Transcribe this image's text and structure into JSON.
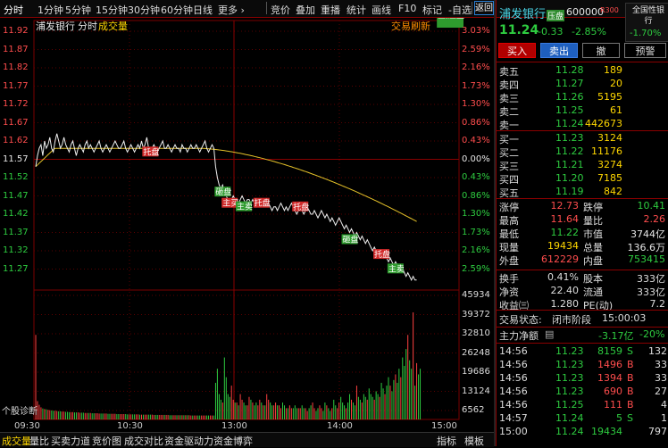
{
  "topbar": {
    "tabs": [
      "分时",
      "1分钟",
      "5分钟",
      "15分钟",
      "30分钟",
      "60分钟",
      "日线",
      "更多 ›"
    ],
    "tools": [
      "竞价",
      "叠加",
      "重播",
      "统计",
      "画线",
      "F10",
      "标记",
      "-自选"
    ],
    "back": "返回"
  },
  "chart": {
    "title_name": "浦发银行",
    "title_mode": "分时",
    "title_ind": "成交量",
    "refresh": "交易刷新",
    "prev_close": 11.57,
    "price_labels": [
      "11.92",
      "11.87",
      "11.82",
      "11.77",
      "11.72",
      "11.67",
      "11.62",
      "11.57",
      "11.52",
      "11.47",
      "11.42",
      "11.37",
      "11.32",
      "11.27"
    ],
    "pct_labels": [
      "3.03%",
      "2.59%",
      "2.16%",
      "1.73%",
      "1.30%",
      "0.86%",
      "0.43%",
      "0.00%",
      "0.43%",
      "0.86%",
      "1.30%",
      "1.73%",
      "2.16%",
      "2.59%"
    ],
    "vol_labels": [
      "45934",
      "39372",
      "32810",
      "26248",
      "19686",
      "13124",
      "6562"
    ],
    "time_labels": [
      "09:30",
      "10:30",
      "13:00",
      "14:00",
      "15:00"
    ],
    "diagnose": "个股诊断",
    "markers": [
      {
        "t": 65,
        "label": "托盘",
        "type": "buy"
      },
      {
        "t": 106,
        "label": "砸盘",
        "type": "sell"
      },
      {
        "t": 110,
        "label": "主买",
        "type": "buy"
      },
      {
        "t": 118,
        "label": "主卖",
        "type": "sell"
      },
      {
        "t": 128,
        "label": "托盘",
        "type": "buy"
      },
      {
        "t": 150,
        "label": "托盘",
        "type": "buy"
      },
      {
        "t": 178,
        "label": "砸盘",
        "type": "sell"
      },
      {
        "t": 196,
        "label": "托盘",
        "type": "buy"
      },
      {
        "t": 204,
        "label": "主卖",
        "type": "sell"
      },
      {
        "t": 232,
        "label": "主卖",
        "type": "sell"
      },
      {
        "t": 238,
        "label": "压盘",
        "type": "sell"
      }
    ],
    "price_series": [
      11.55,
      11.58,
      11.6,
      11.61,
      11.58,
      11.62,
      11.6,
      11.61,
      11.63,
      11.6,
      11.59,
      11.62,
      11.64,
      11.62,
      11.6,
      11.61,
      11.63,
      11.61,
      11.6,
      11.59,
      11.61,
      11.62,
      11.6,
      11.58,
      11.6,
      11.61,
      11.6,
      11.59,
      11.61,
      11.62,
      11.6,
      11.61,
      11.6,
      11.59,
      11.6,
      11.61,
      11.62,
      11.6,
      11.59,
      11.6,
      11.61,
      11.6,
      11.59,
      11.6,
      11.61,
      11.62,
      11.61,
      11.6,
      11.6,
      11.61,
      11.62,
      11.6,
      11.59,
      11.6,
      11.61,
      11.6,
      11.59,
      11.6,
      11.61,
      11.6,
      11.62,
      11.6,
      11.61,
      11.63,
      11.6,
      11.59,
      11.6,
      11.61,
      11.6,
      11.59,
      11.6,
      11.61,
      11.62,
      11.6,
      11.6,
      11.61,
      11.6,
      11.59,
      11.6,
      11.61,
      11.6,
      11.6,
      11.59,
      11.61,
      11.6,
      11.6,
      11.59,
      11.6,
      11.61,
      11.6,
      11.6,
      11.61,
      11.6,
      11.59,
      11.6,
      11.61,
      11.62,
      11.6,
      11.59,
      11.6,
      11.61,
      11.6,
      11.55,
      11.52,
      11.5,
      11.49,
      11.5,
      11.48,
      11.47,
      11.46,
      11.45,
      11.46,
      11.47,
      11.46,
      11.46,
      11.45,
      11.46,
      11.47,
      11.46,
      11.45,
      11.46,
      11.46,
      11.45,
      11.46,
      11.45,
      11.44,
      11.45,
      11.46,
      11.45,
      11.45,
      11.44,
      11.44,
      11.45,
      11.44,
      11.43,
      11.44,
      11.44,
      11.43,
      11.44,
      11.45,
      11.44,
      11.43,
      11.44,
      11.43,
      11.44,
      11.45,
      11.44,
      11.43,
      11.42,
      11.43,
      11.44,
      11.43,
      11.42,
      11.43,
      11.44,
      11.43,
      11.42,
      11.42,
      11.43,
      11.42,
      11.41,
      11.42,
      11.43,
      11.42,
      11.41,
      11.42,
      11.41,
      11.4,
      11.41,
      11.4,
      11.39,
      11.4,
      11.41,
      11.4,
      11.39,
      11.38,
      11.39,
      11.38,
      11.37,
      11.38,
      11.37,
      11.36,
      11.37,
      11.36,
      11.35,
      11.36,
      11.35,
      11.34,
      11.35,
      11.34,
      11.33,
      11.32,
      11.33,
      11.32,
      11.31,
      11.32,
      11.31,
      11.3,
      11.31,
      11.3,
      11.29,
      11.3,
      11.29,
      11.28,
      11.29,
      11.28,
      11.27,
      11.28,
      11.27,
      11.26,
      11.25,
      11.26,
      11.25,
      11.24,
      11.25,
      11.24,
      11.24
    ],
    "avg_series_start": 11.55,
    "avg_series_end": 11.4,
    "volumes": [
      30000,
      6500,
      5200,
      4300,
      3900,
      3700,
      3600,
      3400,
      3300,
      3200,
      3100,
      3100,
      3000,
      2900,
      2900,
      2800,
      2800,
      2700,
      2700,
      2600,
      2600,
      2600,
      2500,
      2500,
      2500,
      2400,
      2400,
      2400,
      2300,
      2300,
      2300,
      2300,
      2200,
      2200,
      2200,
      2200,
      2100,
      2100,
      2100,
      2100,
      2100,
      2000,
      2000,
      2000,
      2000,
      2000,
      1900,
      1900,
      1900,
      1900,
      1900,
      1900,
      1800,
      1800,
      1800,
      1800,
      1800,
      1800,
      1800,
      1700,
      1700,
      1700,
      1700,
      1700,
      1700,
      1700,
      1700,
      1600,
      1600,
      1600,
      1600,
      1600,
      1600,
      1600,
      1600,
      1600,
      1500,
      1500,
      1500,
      1500,
      1500,
      1500,
      1500,
      1500,
      1500,
      1500,
      1500,
      1500,
      1400,
      1400,
      1400,
      1400,
      1400,
      1400,
      1400,
      1400,
      1400,
      1400,
      1400,
      1400,
      1400,
      1400,
      13000,
      18000,
      9000,
      7000,
      6000,
      22000,
      15000,
      9000,
      8000,
      12000,
      7000,
      6000,
      6000,
      5000,
      9000,
      7000,
      6000,
      5000,
      5000,
      8000,
      7000,
      6000,
      5000,
      6000,
      5000,
      7000,
      6000,
      5000,
      5000,
      9000,
      7000,
      6000,
      5000,
      5000,
      6000,
      5000,
      5000,
      4000,
      6000,
      5000,
      4000,
      4000,
      5000,
      4000,
      4000,
      5000,
      4000,
      4000,
      4000,
      5000,
      4000,
      4000,
      3000,
      4000,
      5000,
      6000,
      4000,
      3000,
      4000,
      5000,
      4000,
      3000,
      6000,
      5000,
      4000,
      3000,
      4000,
      7000,
      5000,
      4000,
      6000,
      8000,
      6000,
      5000,
      4000,
      6000,
      9000,
      7000,
      6000,
      5000,
      12000,
      8000,
      7000,
      6000,
      9000,
      8000,
      7000,
      11000,
      9000,
      8000,
      7000,
      10000,
      9000,
      8000,
      13000,
      11000,
      9000,
      12000,
      15000,
      12000,
      10000,
      14000,
      16000,
      13000,
      18000,
      15000,
      22000,
      19000,
      25000,
      30000,
      21000,
      18000,
      38000,
      12000,
      20000,
      16000,
      18000
    ]
  },
  "panel": {
    "name": "浦发银行",
    "tag": "压盘",
    "code": "600000",
    "r_badge": "R300",
    "nat_label": "全国性银行",
    "nat_value": "-1.70%",
    "price": "11.24",
    "change": "-0.33",
    "change_pct": "-2.85%",
    "buy_btn": "买入",
    "sell_btn": "卖出",
    "cancel_btn": "撤",
    "warn_btn": "预警",
    "asks": [
      {
        "label": "卖五",
        "price": "11.28",
        "vol": "189"
      },
      {
        "label": "卖四",
        "price": "11.27",
        "vol": "20"
      },
      {
        "label": "卖三",
        "price": "11.26",
        "vol": "5195"
      },
      {
        "label": "卖二",
        "price": "11.25",
        "vol": "61"
      },
      {
        "label": "卖一",
        "price": "11.24",
        "vol": "442673"
      }
    ],
    "bids": [
      {
        "label": "买一",
        "price": "11.23",
        "vol": "3124"
      },
      {
        "label": "买二",
        "price": "11.22",
        "vol": "11176"
      },
      {
        "label": "买三",
        "price": "11.21",
        "vol": "3274"
      },
      {
        "label": "买四",
        "price": "11.20",
        "vol": "7185"
      },
      {
        "label": "买五",
        "price": "11.19",
        "vol": "842"
      }
    ],
    "stats": [
      {
        "l1": "涨停",
        "v1": "12.73",
        "c1": "red",
        "l2": "跌停",
        "v2": "10.41",
        "c2": "green"
      },
      {
        "l1": "最高",
        "v1": "11.64",
        "c1": "red",
        "l2": "量比",
        "v2": "2.26",
        "c2": "red"
      },
      {
        "l1": "最低",
        "v1": "11.22",
        "c1": "green",
        "l2": "市值",
        "v2": "3744亿",
        "c2": "white"
      },
      {
        "l1": "现量",
        "v1": "19434",
        "c1": "yellow",
        "l2": "总量",
        "v2": "136.6万",
        "c2": "white"
      },
      {
        "l1": "外盘",
        "v1": "612229",
        "c1": "red",
        "l2": "内盘",
        "v2": "753415",
        "c2": "green"
      }
    ],
    "stats2": [
      {
        "l1": "换手",
        "v1": "0.41%",
        "l2": "股本",
        "v2": "333亿"
      },
      {
        "l1": "净资",
        "v1": "22.40",
        "l2": "流通",
        "v2": "333亿"
      },
      {
        "l1": "收益㈢",
        "v1": "1.280",
        "l2": "PE(动)",
        "v2": "7.2"
      }
    ],
    "state_label": "交易状态:",
    "state_value": "闭市阶段",
    "state_time": "15:00:03",
    "main_flow_label": "主力净额",
    "main_flow_value": "-3.17亿",
    "main_flow_pct": "-20%",
    "ticks": [
      {
        "time": "14:56",
        "price": "11.23",
        "vol": "8159",
        "side": "S",
        "n": "132"
      },
      {
        "time": "14:56",
        "price": "11.23",
        "vol": "1496",
        "side": "B",
        "n": "33"
      },
      {
        "time": "14:56",
        "price": "11.23",
        "vol": "1394",
        "side": "B",
        "n": "33"
      },
      {
        "time": "14:56",
        "price": "11.23",
        "vol": "690",
        "side": "B",
        "n": "27"
      },
      {
        "time": "14:56",
        "price": "11.25",
        "vol": "111",
        "side": "B",
        "n": "4"
      },
      {
        "time": "14:57",
        "price": "11.24",
        "vol": "5",
        "side": "S",
        "n": "1"
      },
      {
        "time": "15:00",
        "price": "11.24",
        "vol": "19434",
        "side": "",
        "n": "797"
      }
    ]
  },
  "bottombar": {
    "tabs": [
      "成交量",
      "量比",
      "买卖力道",
      "竞价图",
      "成交对比",
      "资金驱动力",
      "资金博弈"
    ],
    "right": [
      "指标",
      "模板"
    ]
  }
}
